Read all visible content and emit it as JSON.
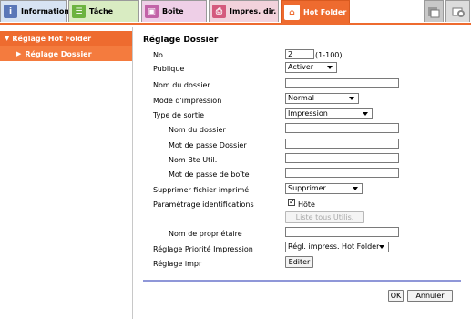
{
  "tabs": [
    {
      "label": "Information",
      "icon": "information-icon"
    },
    {
      "label": "Tâche",
      "icon": "task-icon"
    },
    {
      "label": "Boîte",
      "icon": "box-icon"
    },
    {
      "label": "Impres. dir.",
      "icon": "direct-print-icon"
    },
    {
      "label": "Hot Folder",
      "icon": "hot-folder-icon",
      "active": true
    }
  ],
  "sidebar": {
    "group": "Réglage Hot Folder",
    "items": [
      {
        "label": "Réglage Dossier",
        "selected": true
      }
    ]
  },
  "form": {
    "title": "Réglage Dossier",
    "no_label": "No.",
    "no_value": "2",
    "no_range": "(1-100)",
    "publique_label": "Publique",
    "publique_value": "Activer",
    "nom_dossier_label": "Nom du dossier",
    "nom_dossier_value": "",
    "mode_label": "Mode d'impression",
    "mode_value": "Normal",
    "type_sortie_label": "Type de sortie",
    "type_sortie_value": "Impression",
    "sub_nom_dossier_label": "Nom du dossier",
    "sub_mdp_dossier_label": "Mot de passe Dossier",
    "sub_nom_bte_label": "Nom Bte Util.",
    "sub_mdp_boite_label": "Mot de passe de boîte",
    "suppr_label": "Supprimer fichier imprimé",
    "suppr_value": "Supprimer",
    "param_label": "Paramétrage identifications",
    "hote_label": "Hôte",
    "hote_checked": true,
    "liste_button": "Liste tous Utilis.",
    "proprio_label": "Nom de propriétaire",
    "priorite_label": "Réglage Priorité Impression",
    "priorite_value": "Régl. impress. Hot Folder",
    "reglage_impr_label": "Réglage impr",
    "editer_button": "Editer",
    "ok_button": "OK",
    "annuler_button": "Annuler"
  },
  "colors": {
    "accent": "#ee6b2f",
    "divider": "#8f97d8"
  }
}
